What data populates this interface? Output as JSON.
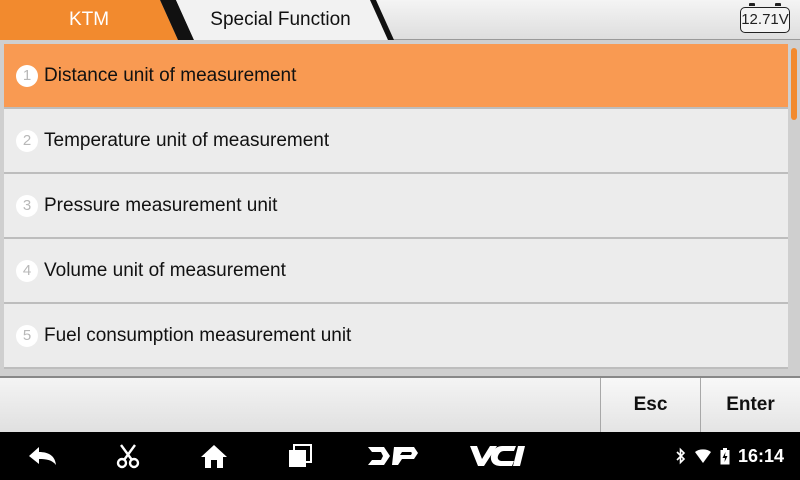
{
  "header": {
    "vehicle_make": "KTM",
    "menu_title": "Special Function",
    "battery_voltage": "12.71V"
  },
  "menu": {
    "items": [
      {
        "number": "1",
        "label": "Distance unit of measurement",
        "selected": true
      },
      {
        "number": "2",
        "label": "Temperature unit of measurement",
        "selected": false
      },
      {
        "number": "3",
        "label": "Pressure measurement unit",
        "selected": false
      },
      {
        "number": "4",
        "label": "Volume unit of measurement",
        "selected": false
      },
      {
        "number": "5",
        "label": "Fuel consumption measurement unit",
        "selected": false
      }
    ]
  },
  "actions": {
    "esc_label": "Esc",
    "enter_label": "Enter"
  },
  "navbar": {
    "icons": [
      "back-icon",
      "scissors-icon",
      "home-icon",
      "recent-apps-icon",
      "dp-icon",
      "vci-icon"
    ],
    "dp_label": "DP",
    "vci_label": "VCI"
  },
  "status": {
    "time": "16:14",
    "icons": [
      "bluetooth-icon",
      "wifi-icon",
      "battery-icon"
    ]
  },
  "colors": {
    "accent_orange": "#f28a2e",
    "selected_row": "#f99a52"
  }
}
